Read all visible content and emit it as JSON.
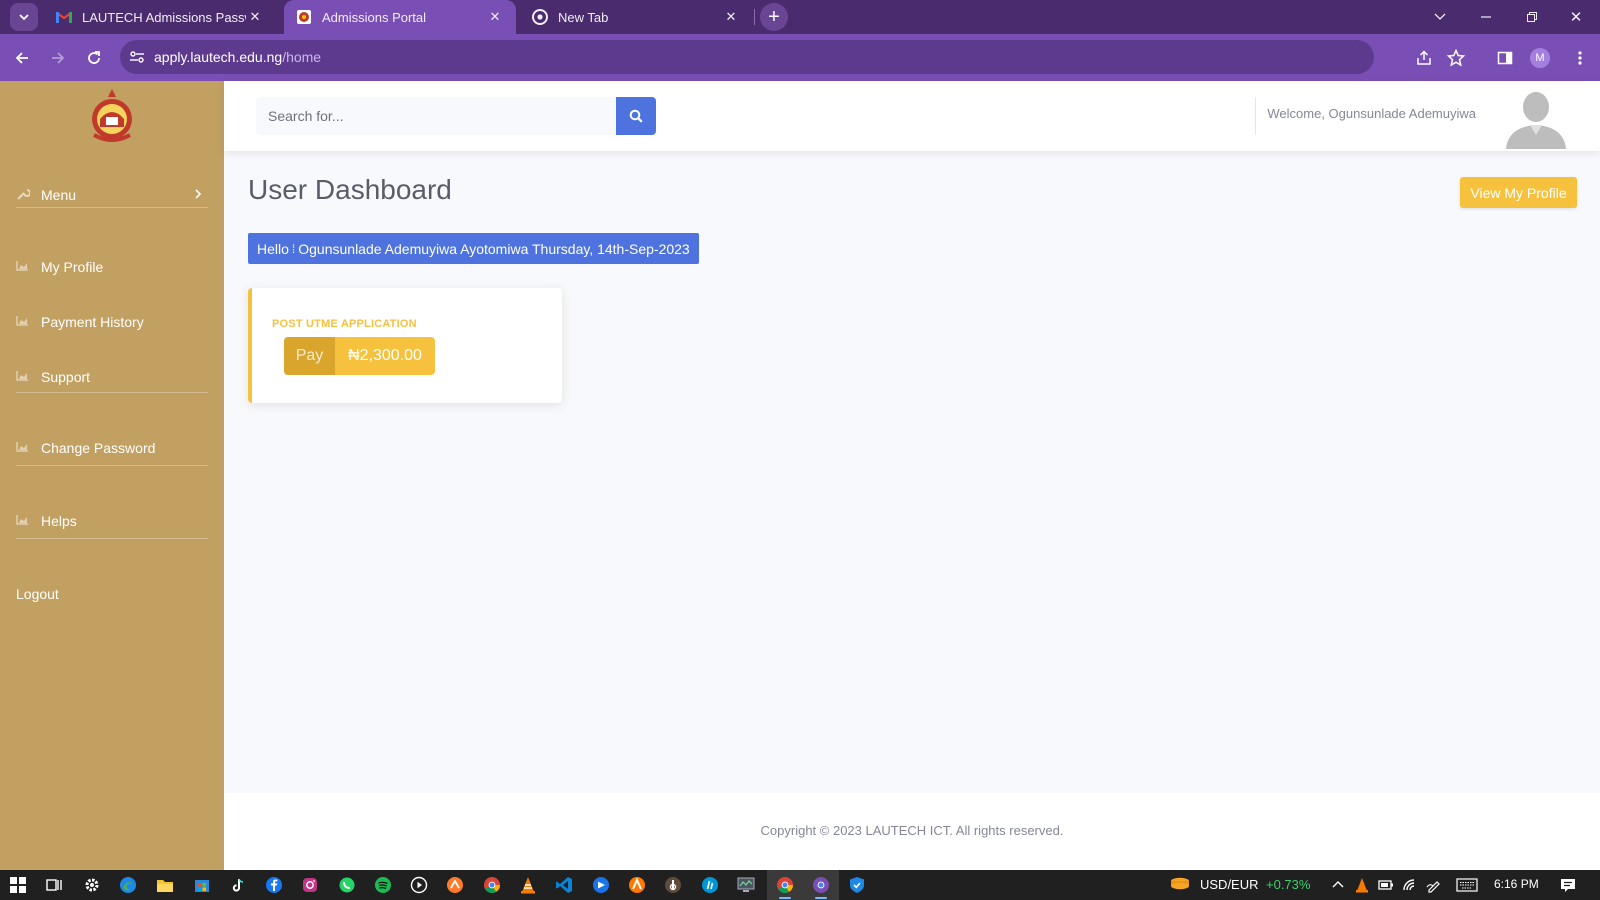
{
  "browser": {
    "tabs": [
      {
        "title": "LAUTECH Admissions Password",
        "favicon": "gmail-icon"
      },
      {
        "title": "Admissions Portal",
        "favicon": "lautech-crest-icon"
      },
      {
        "title": "New Tab",
        "favicon": "chrome-icon"
      }
    ],
    "url_host": "apply.lautech.edu.ng",
    "url_path": "/home",
    "profile_initial": "M"
  },
  "sidebar": {
    "menu_label": "Menu",
    "items": [
      {
        "label": "My Profile",
        "icon": "chart-area-icon"
      },
      {
        "label": "Payment History",
        "icon": "chart-area-icon"
      },
      {
        "label": "Support",
        "icon": "chart-area-icon"
      },
      {
        "label": "Change Password",
        "icon": "chart-area-icon"
      },
      {
        "label": "Helps",
        "icon": "chart-area-icon"
      }
    ],
    "logout_label": "Logout"
  },
  "topbar": {
    "search_placeholder": "Search for...",
    "welcome_text": "Welcome, Ogunsunlade Ademuyiwa"
  },
  "main": {
    "title": "User Dashboard",
    "profile_button": "View My Profile",
    "hello_prefix": "Hello",
    "hello_separator": "⁞",
    "hello_name_date": "Ogunsunlade Ademuyiwa Ayotomiwa Thursday, 14th-Sep-2023",
    "card": {
      "label": "POST UTME APPLICATION",
      "pay_label": "Pay",
      "amount": "₦2,300.00"
    }
  },
  "footer": {
    "copyright": "Copyright © 2023 LAUTECH ICT. All rights reserved."
  },
  "taskbar": {
    "ticker_symbol": "USD/EUR",
    "ticker_change": "+0.73%",
    "time": "6:16 PM"
  },
  "colors": {
    "sidebar": "#c2a062",
    "primary": "#4e73df",
    "warning": "#f6c23e",
    "browser_frame": "#7a4fb5",
    "ticker_positive": "#3ccf6e"
  }
}
